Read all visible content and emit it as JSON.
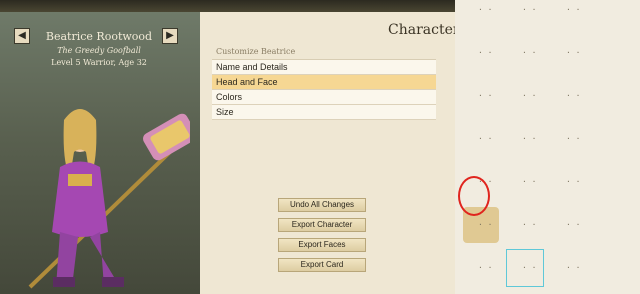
{
  "top_message": "",
  "hero": {
    "name": "Beatrice Rootwood",
    "title": "The Greedy Goofball",
    "level_line": "Level 5 Warrior, Age 32",
    "prev_icon": "arrow-left-icon",
    "next_icon": "arrow-right-icon"
  },
  "main": {
    "title": "Character",
    "menu_header": "Customize Beatrice",
    "menu_items": [
      "Name and Details",
      "Head and Face",
      "Colors",
      "Size"
    ],
    "active_index": 1,
    "buttons": [
      "Undo All Changes",
      "Export Character",
      "Export Faces",
      "Export Card"
    ]
  },
  "grid": {
    "cells": [
      "",
      "",
      "",
      "",
      "",
      "",
      "",
      "",
      "",
      "",
      "",
      "",
      "",
      "",
      "",
      "",
      "",
      "",
      "",
      "",
      ""
    ]
  },
  "colors": {
    "accent": "#f6d793",
    "annotation": "#e0251e",
    "selection": "#5fc8d8"
  }
}
